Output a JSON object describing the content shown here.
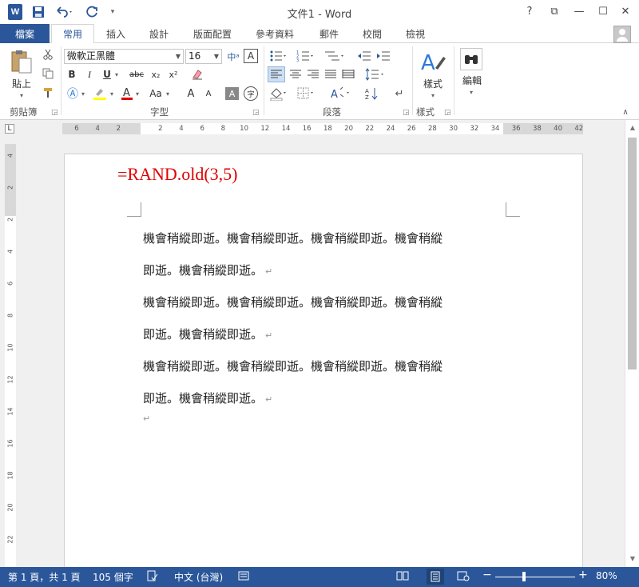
{
  "titlebar": {
    "logo_letter": "W",
    "title": "文件1 - Word",
    "help": "?",
    "ribbon_display": "⧉",
    "minimize": "—",
    "maximize": "☐",
    "close": "✕"
  },
  "tabs": {
    "file": "檔案",
    "items": [
      "常用",
      "插入",
      "設計",
      "版面配置",
      "參考資料",
      "郵件",
      "校閱",
      "檢視"
    ],
    "active": "常用"
  },
  "ribbon": {
    "clipboard": {
      "paste": "貼上",
      "group": "剪貼簿"
    },
    "font": {
      "name": "微軟正黑體",
      "size": "16",
      "group": "字型",
      "bold": "B",
      "italic": "I",
      "underline": "U",
      "strike": "abc",
      "sub": "x₂",
      "sup": "x²",
      "grow": "A",
      "shrink": "A",
      "case": "Aa"
    },
    "paragraph": {
      "group": "段落"
    },
    "styles": {
      "label": "樣式",
      "group": "樣式"
    },
    "editing": {
      "label": "編輯"
    }
  },
  "ruler": {
    "h_ticks": [
      "6",
      "4",
      "2",
      "2",
      "4",
      "6",
      "8",
      "10",
      "12",
      "14",
      "16",
      "18",
      "20",
      "22",
      "24",
      "26",
      "28",
      "30",
      "32",
      "34",
      "36",
      "38",
      "40",
      "42"
    ],
    "v_ticks": [
      "4",
      "2",
      "2",
      "4",
      "6",
      "8",
      "10",
      "12",
      "14",
      "16",
      "18",
      "20",
      "22"
    ]
  },
  "document": {
    "formula": "=RAND.old(3,5)",
    "paragraphs": [
      {
        "line1": "機會稍縱即逝。機會稍縱即逝。機會稍縱即逝。機會稍縱",
        "line2": "即逝。機會稍縱即逝。"
      },
      {
        "line1": "機會稍縱即逝。機會稍縱即逝。機會稍縱即逝。機會稍縱",
        "line2": "即逝。機會稍縱即逝。"
      },
      {
        "line1": "機會稍縱即逝。機會稍縱即逝。機會稍縱即逝。機會稍縱",
        "line2": "即逝。機會稍縱即逝。"
      }
    ],
    "para_mark": "↵"
  },
  "statusbar": {
    "page": "第 1 頁，共 1 頁",
    "words": "105 個字",
    "language": "中文 (台灣)",
    "zoom": "80%",
    "zoom_fraction": 0.36
  }
}
